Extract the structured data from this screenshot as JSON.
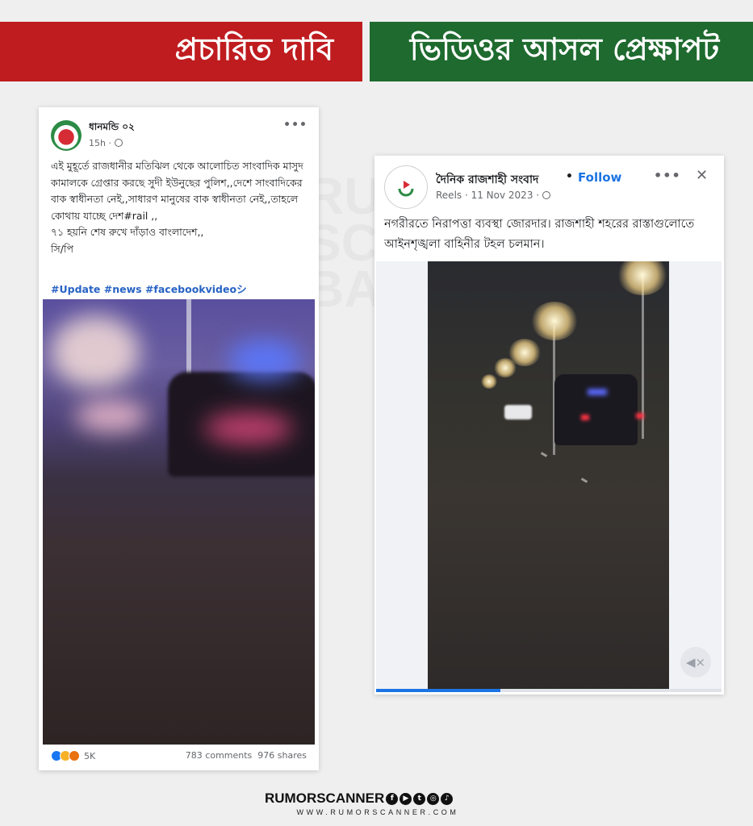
{
  "banners": {
    "claim": "প্রচারিত দাবি",
    "fact": "ভিডিওর আসল প্রেক্ষাপট"
  },
  "left_post": {
    "page_name": "ধানমন্ডি ০২",
    "meta": "15h ·",
    "more_icon": "more-dots-icon",
    "text": "এই মুহূর্তে রাজধানীর মতিঝিল থেকে আলোচিত সাংবাদিক মাসুদ কামালকে গ্রেপ্তার করছে সুদী ইউনুছের পুলিশ,,দেশে সাংবাদিকের বাক স্বাধীনতা নেই,,সাধারণ মানুষের বাক স্বাধীনতা নেই,,তাহলে কোথায় যাচ্ছে দেশ#rail ,,\n৭১ হয়নি শেষ রুখে দাঁড়াও বাংলাদেশ,,\nসি/পি",
    "hashtags": "#Update #news #facebookvideoシ",
    "reaction_count": "5K",
    "comments": "783 comments",
    "shares": "976 shares"
  },
  "right_post": {
    "page_name": "দৈনিক রাজশাহী সংবাদ",
    "separator": "•",
    "follow_label": "Follow",
    "meta": "Reels · 11 Nov 2023 ·",
    "close_icon": "close-icon",
    "text": "নগরীরতে নিরাপত্তা ব্যবস্থা জোরদার। রাজশাহী শহরের রাস্তাগুলোতে আইনশৃঙ্খলা বাহিনীর টহল চলমান।",
    "video_progress": 0.36
  },
  "footer": {
    "brand": "RUMORSCANNER",
    "url": "WWW.RUMORSCANNER.COM",
    "social_icons": [
      "facebook-icon",
      "youtube-icon",
      "twitter-icon",
      "instagram-icon",
      "tiktok-icon"
    ]
  },
  "colors": {
    "claim_banner": "#bf1c1f",
    "fact_banner": "#1e6a2f",
    "link_blue": "#1b74e4",
    "hashtag_blue": "#2763c4"
  }
}
